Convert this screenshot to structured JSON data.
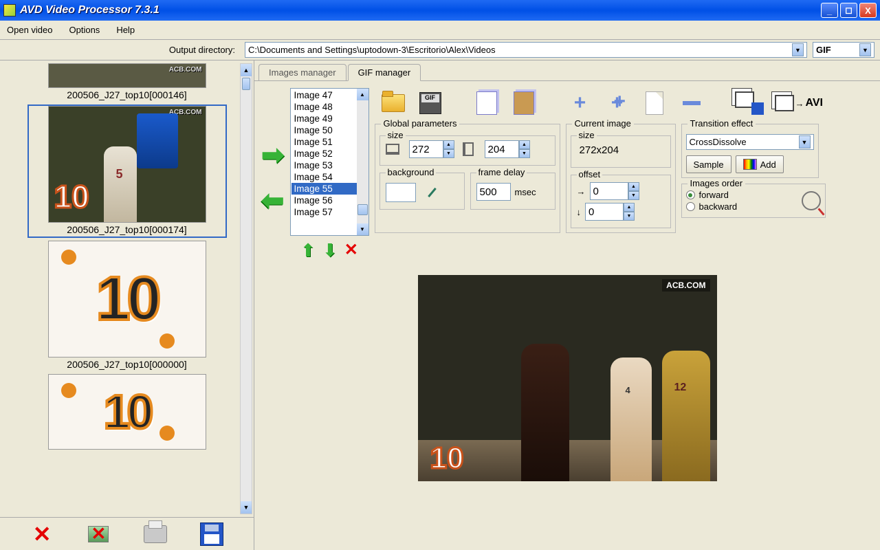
{
  "window": {
    "title": "AVD Video Processor 7.3.1"
  },
  "menu": {
    "open": "Open video",
    "options": "Options",
    "help": "Help"
  },
  "output": {
    "label": "Output directory:",
    "path": "C:\\Documents and Settings\\uptodown-3\\Escritorio\\Alex\\Videos",
    "format": "GIF"
  },
  "thumbs": [
    {
      "caption": "200506_J27_top10[000146]"
    },
    {
      "caption": "200506_J27_top10[000174]"
    },
    {
      "caption": "200506_J27_top10[000000]"
    }
  ],
  "tabs": {
    "images": "Images manager",
    "gif": "GIF manager"
  },
  "imagelist": [
    "Image 47",
    "Image 48",
    "Image 49",
    "Image 50",
    "Image 51",
    "Image 52",
    "Image 53",
    "Image 54",
    "Image 55",
    "Image 56",
    "Image 57"
  ],
  "imagelist_selected": "Image 55",
  "toolbar": {
    "avi": "AVI"
  },
  "global": {
    "title": "Global parameters",
    "size": "size",
    "w": "272",
    "h": "204",
    "bg": "background",
    "fd": "frame delay",
    "delay": "500",
    "unit": "msec"
  },
  "current": {
    "title": "Current image",
    "size": "size",
    "dims": "272x204",
    "offset": "offset",
    "ox": "0",
    "oy": "0"
  },
  "transition": {
    "title": "Transition effect",
    "value": "CrossDissolve",
    "sample": "Sample",
    "add": "Add"
  },
  "order": {
    "title": "Images order",
    "fwd": "forward",
    "bwd": "backward"
  },
  "preview": {
    "watermark": "ACB.COM"
  }
}
